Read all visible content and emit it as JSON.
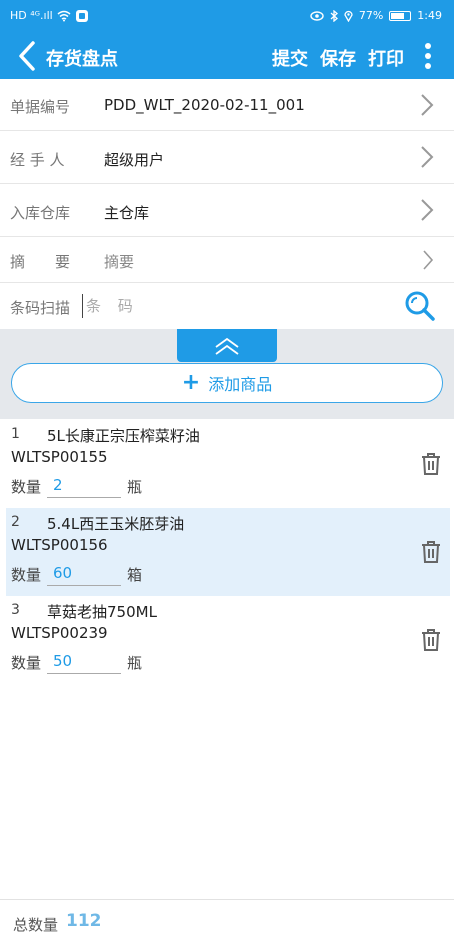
{
  "status_bar": {
    "left_glyphs": "HD ⁴ᴳ.ıll",
    "battery_percent": "77%",
    "battery_level": 0.77,
    "time": "1:49"
  },
  "nav": {
    "title": "存货盘点",
    "actions": {
      "submit": "提交",
      "save": "保存",
      "print": "打印"
    }
  },
  "form": {
    "doc_no": {
      "label": "单据编号",
      "value": "PDD_WLT_2020-02-11_001"
    },
    "handler": {
      "label": "经 手 人",
      "value": "超级用户"
    },
    "warehouse": {
      "label": "入库仓库",
      "value": "主仓库"
    },
    "summary": {
      "label": "摘　　要",
      "value": "摘要"
    },
    "barcode": {
      "label": "条码扫描",
      "placeholder": "条 码"
    }
  },
  "add_product_label": "添加商品",
  "qty_label": "数量",
  "items": [
    {
      "index": "1",
      "name": "5L长康正宗压榨菜籽油",
      "code": "WLTSP00155",
      "qty": "2",
      "unit": "瓶"
    },
    {
      "index": "2",
      "name": "5.4L西王玉米胚芽油",
      "code": "WLTSP00156",
      "qty": "60",
      "unit": "箱"
    },
    {
      "index": "3",
      "name": "草菇老抽750ML",
      "code": "WLTSP00239",
      "qty": "50",
      "unit": "瓶"
    }
  ],
  "footer": {
    "total_label": "总数量",
    "total_value": "112"
  },
  "colors": {
    "primary": "#1f9be6",
    "selected_row": "#e3f0fb",
    "band": "#e5e8ec"
  }
}
